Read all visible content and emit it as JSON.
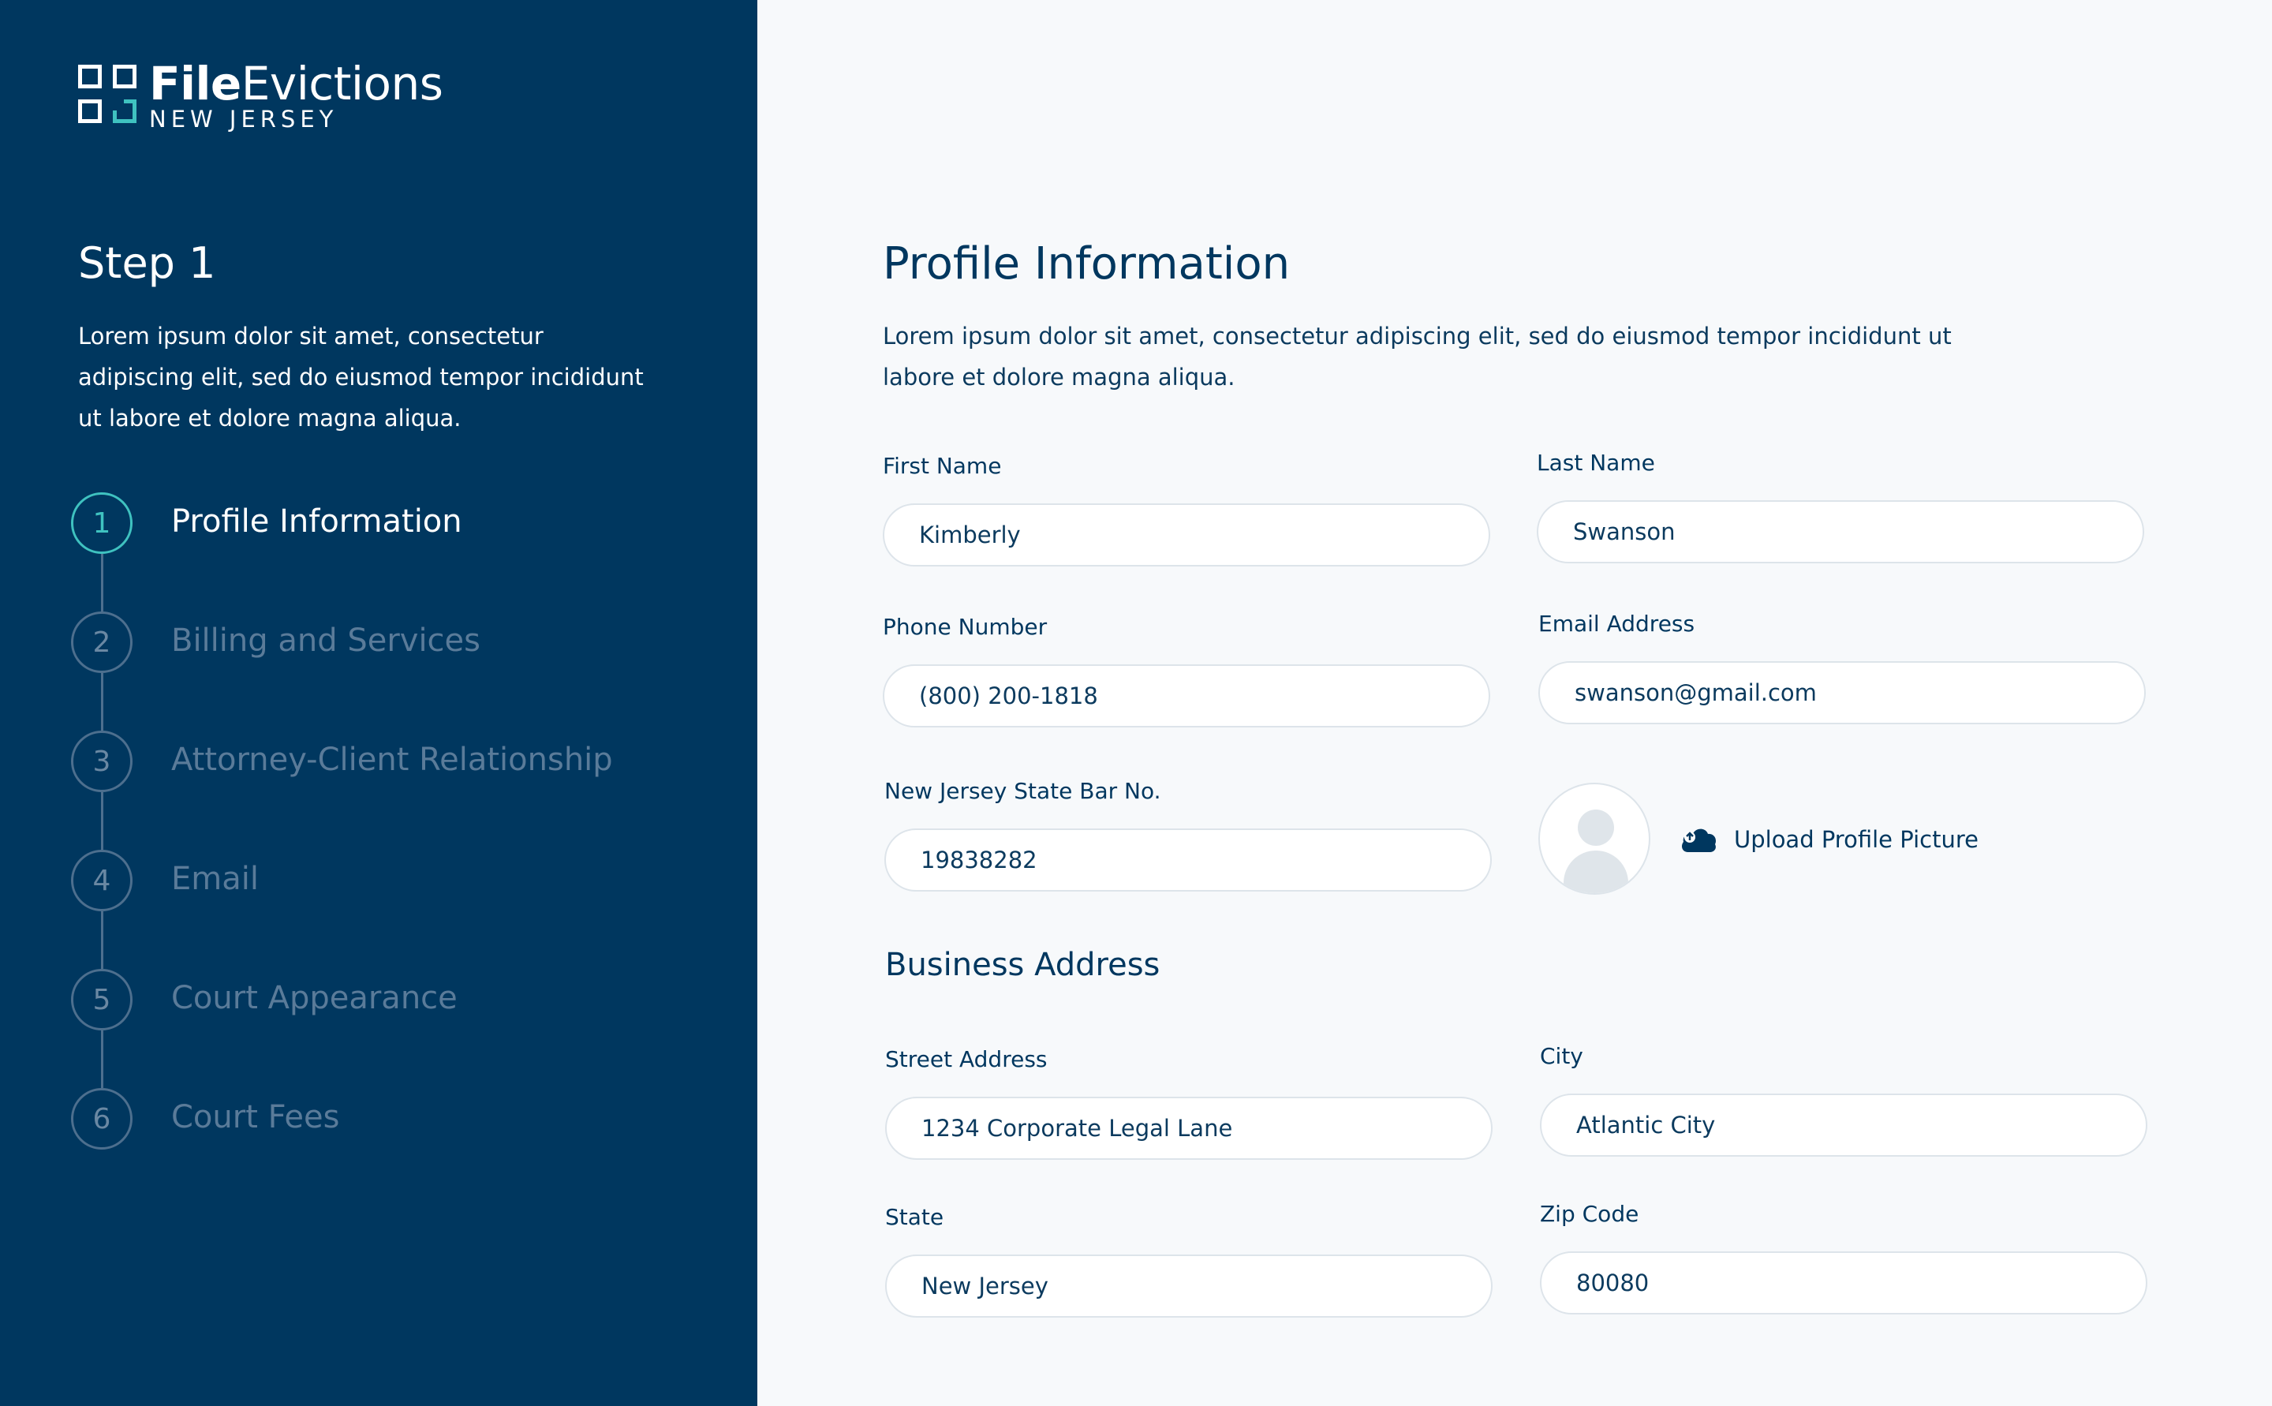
{
  "brand": {
    "name_bold": "File",
    "name_regular": "Evictions",
    "region": "NEW JERSEY"
  },
  "sidebar": {
    "step_title": "Step 1",
    "description": "Lorem ipsum dolor sit amet, consectetur adipiscing elit, sed do eiusmod tempor incididunt ut labore et dolore magna aliqua.",
    "steps": [
      {
        "number": "1",
        "label": "Profile Information",
        "active": true
      },
      {
        "number": "2",
        "label": "Billing and Services",
        "active": false
      },
      {
        "number": "3",
        "label": "Attorney-Client Relationship",
        "active": false
      },
      {
        "number": "4",
        "label": "Email",
        "active": false
      },
      {
        "number": "5",
        "label": "Court Appearance",
        "active": false
      },
      {
        "number": "6",
        "label": "Court Fees",
        "active": false
      }
    ]
  },
  "main": {
    "title": "Profile Information",
    "description": "Lorem ipsum dolor sit amet, consectetur adipiscing elit, sed do eiusmod tempor incididunt ut labore et dolore magna aliqua.",
    "fields": {
      "first_name": {
        "label": "First Name",
        "value": "Kimberly"
      },
      "last_name": {
        "label": "Last Name",
        "value": "Swanson"
      },
      "phone": {
        "label": "Phone Number",
        "value": "(800) 200-1818"
      },
      "email": {
        "label": "Email Address",
        "value": "swanson@gmail.com"
      },
      "bar_no": {
        "label": "New Jersey State Bar No.",
        "value": "19838282"
      }
    },
    "upload_label": "Upload Profile Picture",
    "business_title": "Business Address",
    "address": {
      "street": {
        "label": "Street Address",
        "value": "1234 Corporate Legal Lane"
      },
      "city": {
        "label": "City",
        "value": "Atlantic City"
      },
      "state": {
        "label": "State",
        "value": "New Jersey"
      },
      "zip": {
        "label": "Zip Code",
        "value": "80080"
      }
    }
  },
  "colors": {
    "sidebar": "#00375f",
    "accent": "#3fc2c0",
    "background": "#f7f9fb",
    "inactive_step": "#5a7b99"
  }
}
